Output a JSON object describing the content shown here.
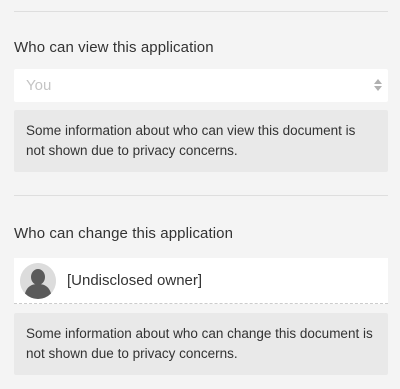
{
  "view_section": {
    "title": "Who can view this application",
    "select": {
      "value": "You"
    },
    "notice": "Some information about who can view this document is not shown due to privacy concerns."
  },
  "change_section": {
    "title": "Who can change this application",
    "owner": {
      "name": "[Undisclosed owner]",
      "icon": "person-avatar-icon"
    },
    "notice": "Some information about who can change this document is not shown due to privacy concerns."
  },
  "colors": {
    "background": "#f4f4f4",
    "info_box": "#e9e9e9",
    "field": "#ffffff",
    "placeholder_text": "#c4c4c4",
    "text": "#333333"
  }
}
